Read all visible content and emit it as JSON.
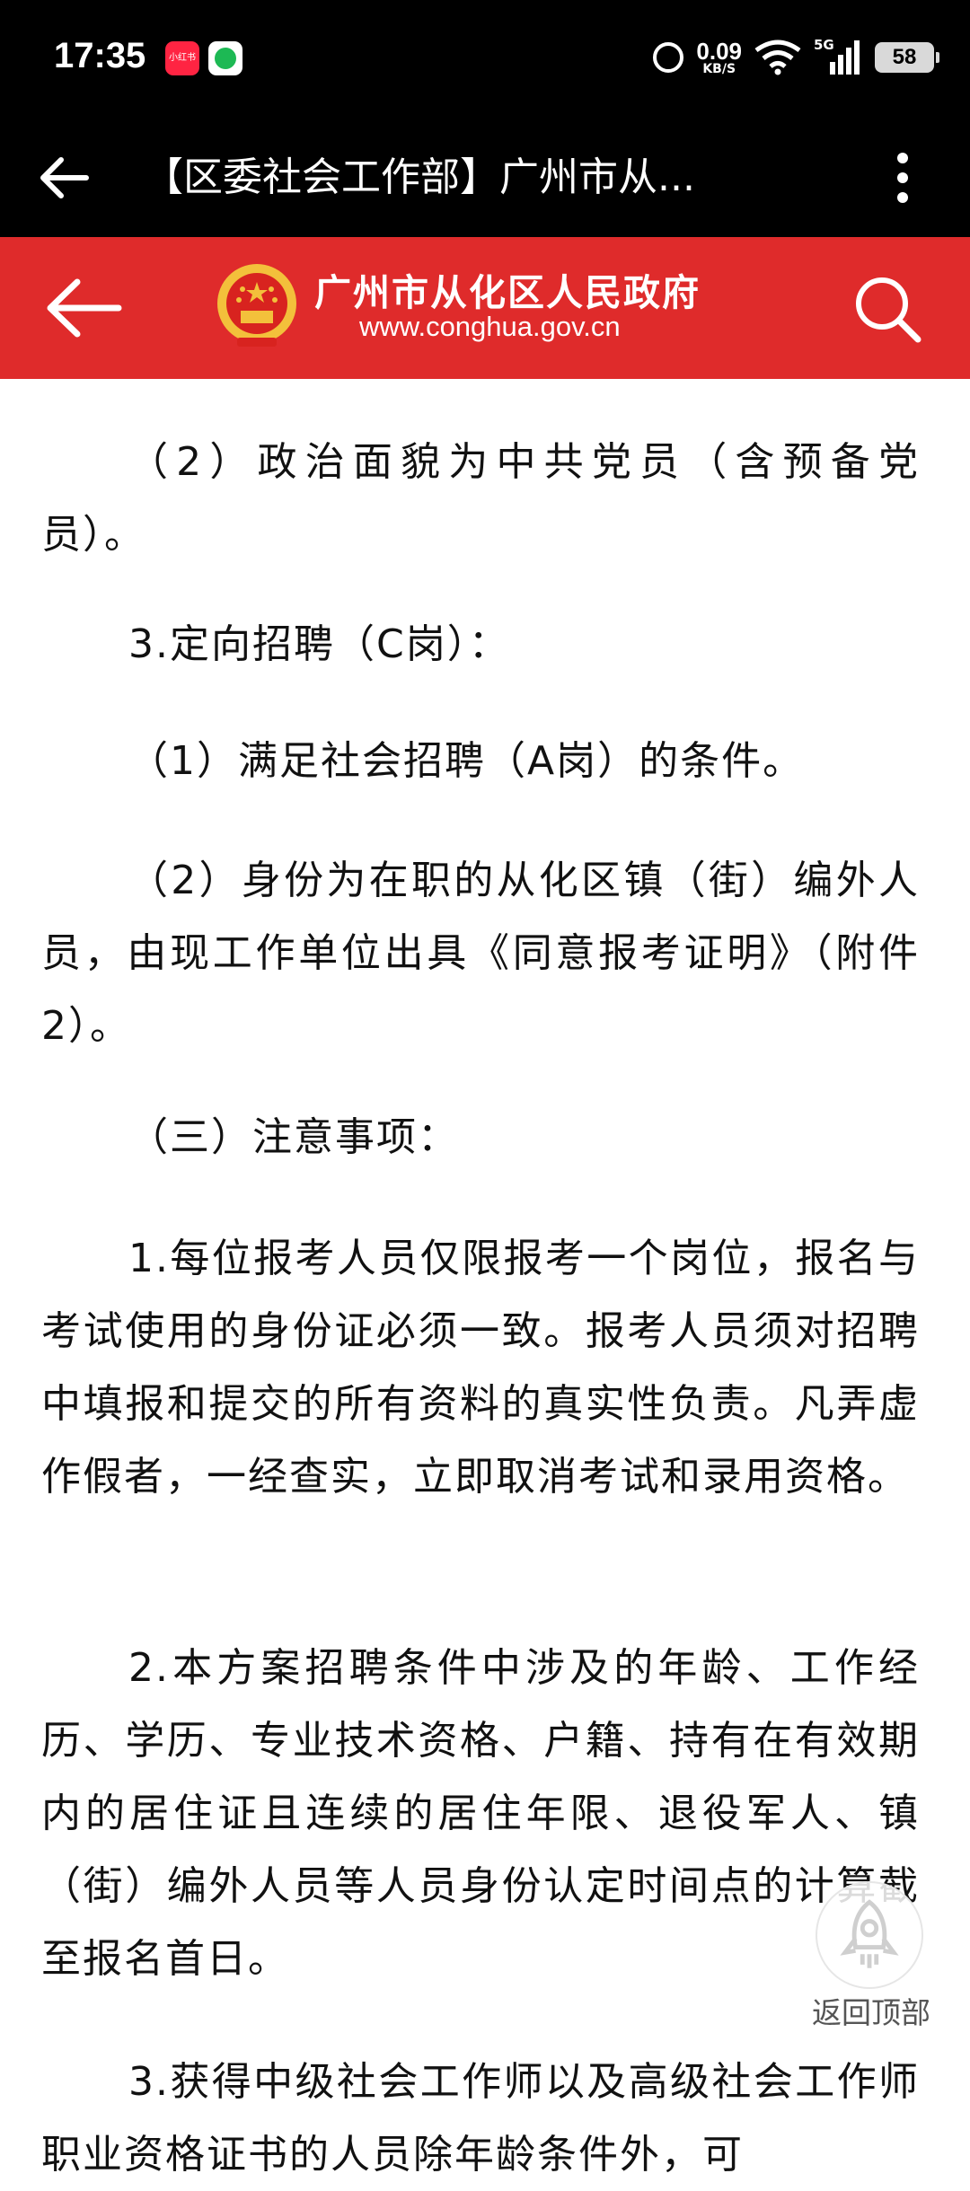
{
  "status_bar": {
    "time": "17:35",
    "app1_label": "小红书",
    "speed_value": "0.09",
    "speed_unit": "KB/S",
    "network": "5G",
    "battery": "58"
  },
  "title_bar": {
    "title": "【区委社会工作部】广州市从..."
  },
  "gov_header": {
    "name": "广州市从化区人民政府",
    "url": "www.conghua.gov.cn"
  },
  "article": {
    "paragraphs": [
      "（2）政治面貌为中共党员（含预备党员）。",
      "3.定向招聘（C岗）：",
      "（1）满足社会招聘（A岗）的条件。",
      "（2）身份为在职的从化区镇（街）编外人员，由现工作单位出具《同意报考证明》（附件2）。",
      "（三）注意事项：",
      "1.每位报考人员仅限报考一个岗位，报名与考试使用的身份证必须一致。报考人员须对招聘中填报和提交的所有资料的真实性负责。凡弄虚作假者，一经查实，立即取消考试和录用资格。",
      "2.本方案招聘条件中涉及的年龄、工作经历、学历、专业技术资格、户籍、持有在有效期内的居住证且连续的居住年限、退役军人、镇（街）编外人员等人员身份认定时间点的计算截至报名首日。",
      "3.获得中级社会工作师以及高级社会工作师职业资格证书的人员除年龄条件外，可"
    ]
  },
  "back_to_top": {
    "label": "返回顶部"
  },
  "colors": {
    "gov_red": "#df2b2b",
    "bar_black": "#000000"
  }
}
